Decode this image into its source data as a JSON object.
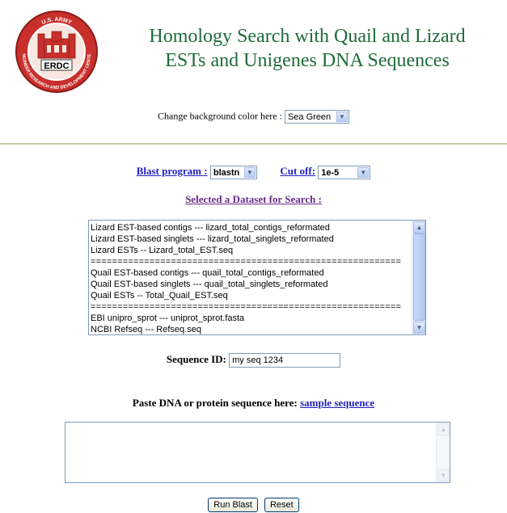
{
  "header": {
    "title_line1": "Homology Search with Quail and Lizard",
    "title_line2": "ESTs and Unigenes DNA Sequences",
    "logo": {
      "top_text": "U.S. ARMY",
      "ring_text": "ENGINEER RESEARCH AND DEVELOPMENT CENTER",
      "center_text": "ERDC",
      "colors": {
        "ring": "#c8302c",
        "inner": "#f7e7e0"
      }
    }
  },
  "background_selector": {
    "label": "Change background color here :",
    "selected": "Sea Green"
  },
  "blast": {
    "program_label": "Blast program :",
    "program_selected": "blastn",
    "cutoff_label": "Cut off:",
    "cutoff_selected": "1e-5"
  },
  "dataset": {
    "heading": "Selected a Dataset for Search :",
    "options": [
      "Lizard EST-based contigs --- lizard_total_contigs_reformated",
      "Lizard EST-based singlets --- lizard_total_singlets_reformated",
      "Lizard ESTs -- Lizard_total_EST.seq",
      "==========================================================",
      "Quail EST-based contigs --- quail_total_contigs_reformated",
      "Quail EST-based singlets --- quail_total_singlets_reformated",
      "Quail ESTs -- Total_Quail_EST.seq",
      "==========================================================",
      "EBI unipro_sprot --- uniprot_sprot.fasta",
      "NCBI Refseq --- Refseq.seq"
    ]
  },
  "sequence_id": {
    "label": "Sequence ID:",
    "value": "my seq 1234"
  },
  "paste": {
    "label": "Paste DNA or protein sequence here:",
    "sample_link": "sample sequence",
    "value": ""
  },
  "buttons": {
    "run": "Run Blast",
    "reset": "Reset"
  },
  "colors": {
    "title": "#1e6b3a",
    "link": "#1f1fbf",
    "heading": "#6b2a8c",
    "divider": "#c8c8a8"
  }
}
